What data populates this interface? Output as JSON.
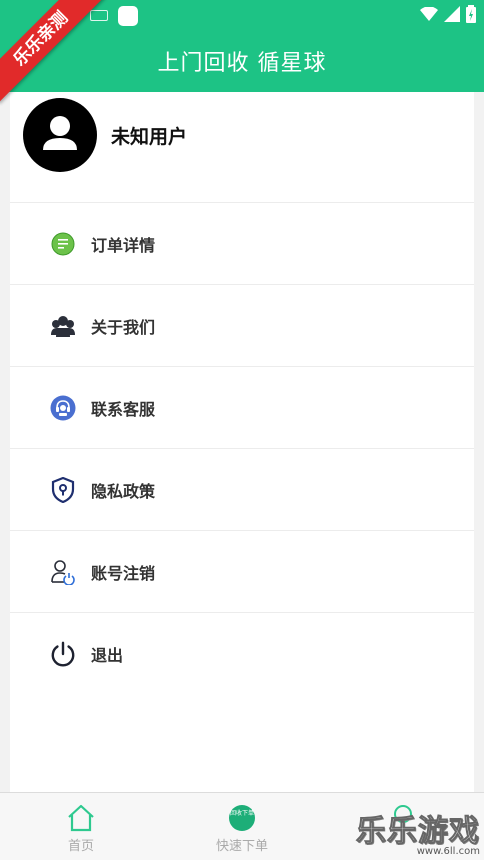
{
  "header": {
    "title": "上门回收 循星球"
  },
  "ribbon": {
    "text": "乐乐亲测"
  },
  "profile": {
    "username": "未知用户"
  },
  "menu": [
    {
      "label": "订单详情",
      "icon": "order-list-icon"
    },
    {
      "label": "关于我们",
      "icon": "group-icon"
    },
    {
      "label": "联系客服",
      "icon": "customer-service-icon"
    },
    {
      "label": "隐私政策",
      "icon": "shield-icon"
    },
    {
      "label": "账号注销",
      "icon": "user-power-icon"
    },
    {
      "label": "退出",
      "icon": "power-icon"
    }
  ],
  "tabbar": {
    "home": "首页",
    "quick_order": "快速下单",
    "quick_order_badge": "回收下单"
  },
  "watermark": {
    "title": "乐乐游戏",
    "url": "www.6ll.com"
  },
  "colors": {
    "primary": "#1dc385",
    "ribbon": "#e12a2a"
  }
}
